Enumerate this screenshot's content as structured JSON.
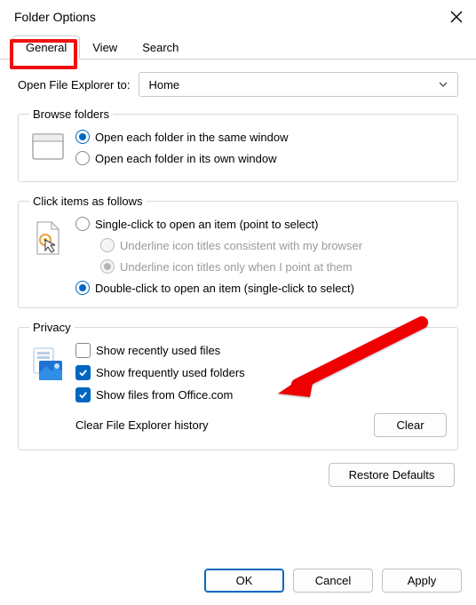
{
  "title": "Folder Options",
  "tabs": {
    "general": "General",
    "view": "View",
    "search": "Search"
  },
  "open_to": {
    "label": "Open File Explorer to:",
    "value": "Home"
  },
  "browse": {
    "legend": "Browse folders",
    "same": "Open each folder in the same window",
    "own": "Open each folder in its own window"
  },
  "click": {
    "legend": "Click items as follows",
    "single": "Single-click to open an item (point to select)",
    "u_browser": "Underline icon titles consistent with my browser",
    "u_point": "Underline icon titles only when I point at them",
    "double": "Double-click to open an item (single-click to select)"
  },
  "privacy": {
    "legend": "Privacy",
    "recent": "Show recently used files",
    "frequent": "Show frequently used folders",
    "office": "Show files from Office.com",
    "clear_label": "Clear File Explorer history",
    "clear_btn": "Clear"
  },
  "restore": "Restore Defaults",
  "buttons": {
    "ok": "OK",
    "cancel": "Cancel",
    "apply": "Apply"
  }
}
